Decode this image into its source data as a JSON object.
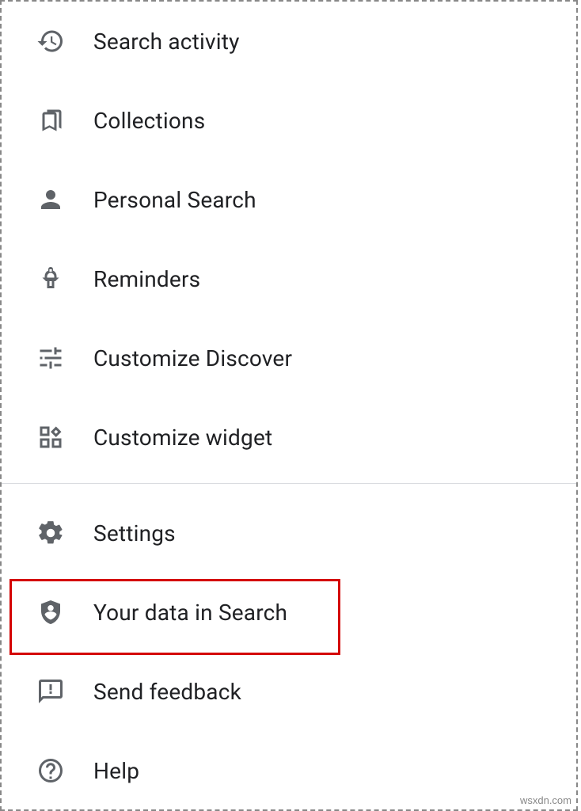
{
  "menu": {
    "section1": [
      {
        "key": "search-activity",
        "label": "Search activity",
        "icon": "history"
      },
      {
        "key": "collections",
        "label": "Collections",
        "icon": "bookmarks"
      },
      {
        "key": "personal-search",
        "label": "Personal Search",
        "icon": "person"
      },
      {
        "key": "reminders",
        "label": "Reminders",
        "icon": "reminder"
      },
      {
        "key": "customize-discover",
        "label": "Customize Discover",
        "icon": "tune"
      },
      {
        "key": "customize-widget",
        "label": "Customize widget",
        "icon": "widgets"
      }
    ],
    "section2": [
      {
        "key": "settings",
        "label": "Settings",
        "icon": "gear"
      },
      {
        "key": "your-data-in-search",
        "label": "Your data in Search",
        "icon": "shield-person"
      },
      {
        "key": "send-feedback",
        "label": "Send feedback",
        "icon": "feedback"
      },
      {
        "key": "help",
        "label": "Help",
        "icon": "help"
      }
    ]
  },
  "highlighted_item": "your-data-in-search",
  "watermark": "wsxdn.com"
}
